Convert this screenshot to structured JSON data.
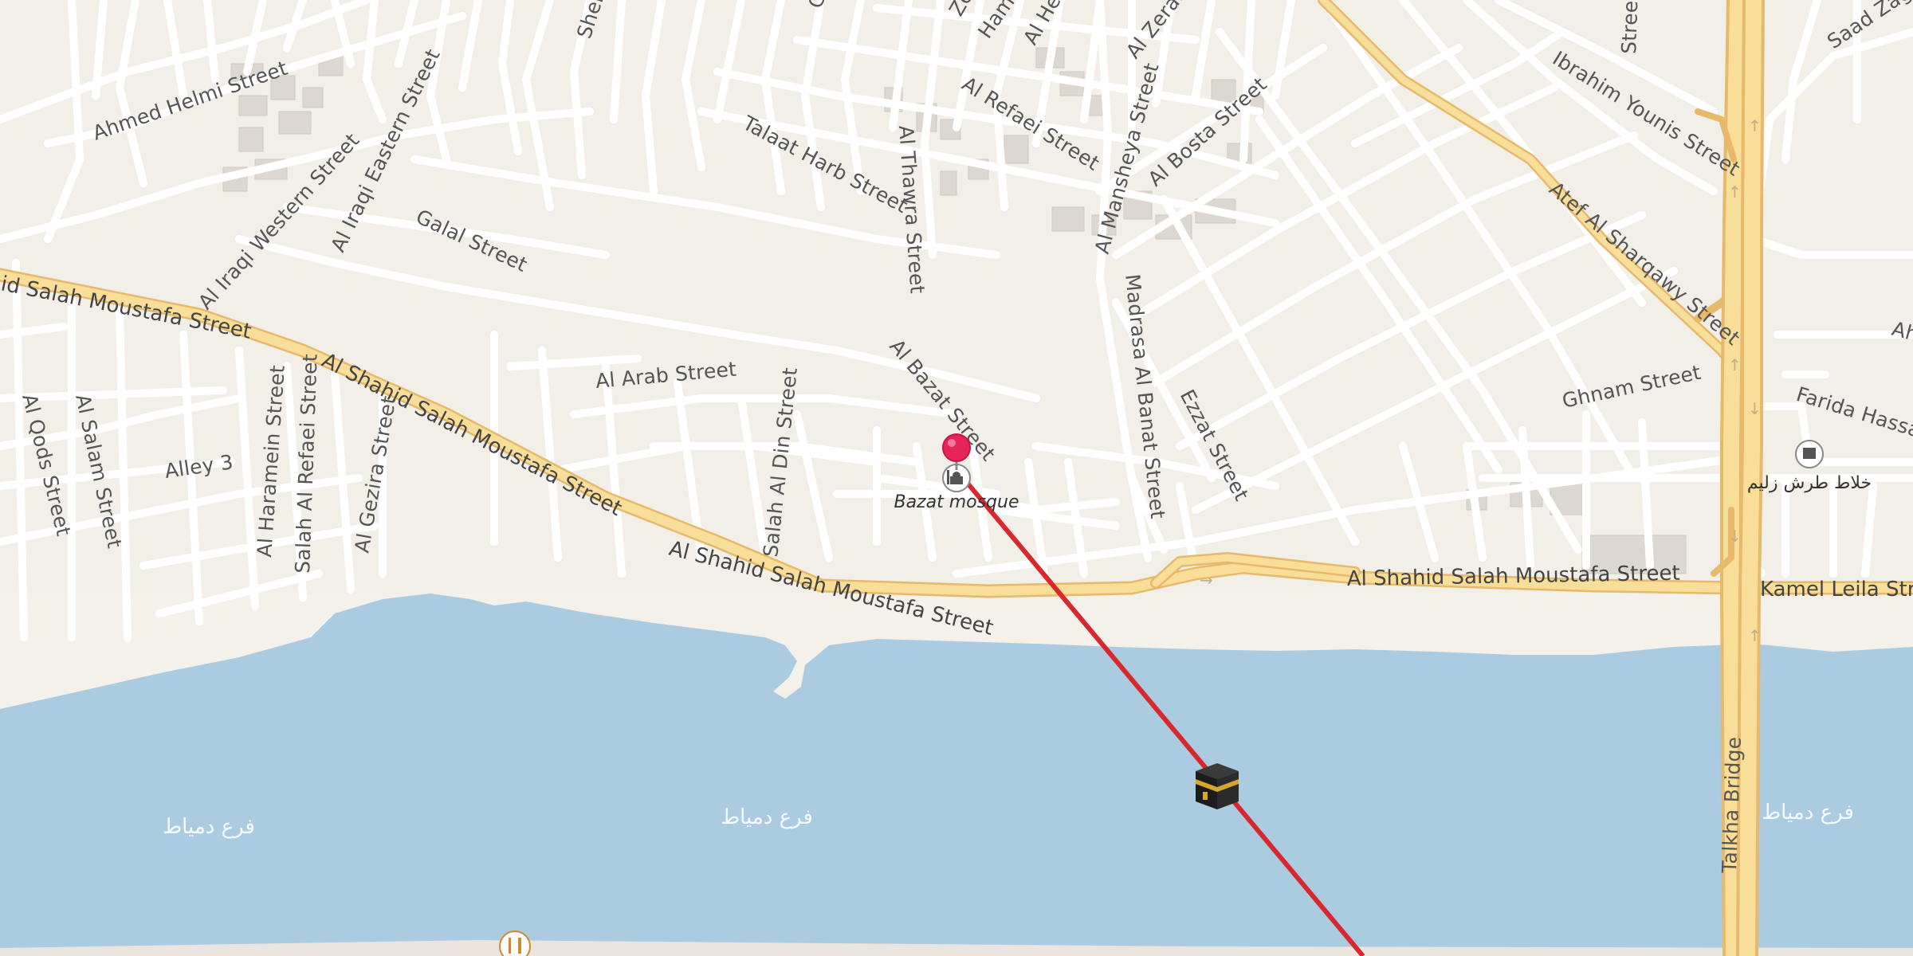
{
  "map": {
    "street_labels": {
      "ahmed_helmi": "Ahmed Helmi Street",
      "talaat_harb": "Talaat Harb Street",
      "al_thawra": "Al Thawra Street",
      "al_refaei": "Al Refaei Street",
      "al_mansheya": "Al Mansheya Street",
      "al_bosta": "Al Bosta Street",
      "al_zeraa": "Al Zeraa",
      "al_heri": "Al Hei",
      "hamo": "Hamo",
      "zey": "Zey",
      "shel": "Shel",
      "g_top": "G",
      "al_iraqi_eastern": "Al Iraqi Eastern Street",
      "al_iraqi_western": "Al Iraqi Western Street",
      "galal": "Galal Street",
      "salah_moustafa_w": "id Salah Moustafa Street",
      "salah_moustafa_diag": "Al Shahid Salah Moustafa Street",
      "salah_moustafa_bottom": "Al Shahid Salah Moustafa Street",
      "salah_moustafa_e": "Al Shahid Salah Moustafa Street",
      "al_arab": "Al Arab Street",
      "al_bazat": "Al Bazat Street",
      "madrasa_al_banat": "Madrasa Al Banat Street",
      "ezzat": "Ezzat Street",
      "salah_al_din": "Salah Al Din Street",
      "al_qods": "Al Qods Street",
      "al_salam": "Al Salam Street",
      "alley_3": "Alley 3",
      "al_haramein": "Al Haramein Street",
      "salah_al_refaei": "Salah Al Refaei Street",
      "al_gezira": "Al Gezira Street",
      "atef_al_sharqawy": "Atef Al Sharqawy Street",
      "ibrahim_younis": "Ibrahim Younis Street",
      "ghnam": "Ghnam Street",
      "farida_hassan": "Farida Hassa",
      "kamel_leila": "Kamel Leila Stre",
      "talkha_bridge": "Talkha Bridge",
      "saad_zag": "Saad Zag",
      "street_top_right": "Street",
      "ah_right": "Ah"
    },
    "water_labels": [
      "فرع دمياط",
      "فرع دمياط",
      "فرع دمياط"
    ],
    "poi": {
      "mosque_name": "Bazat mosque",
      "shop_name": "خلاط طرش زليم"
    },
    "colors": {
      "land": "#f2efe9",
      "water": "#abcbe1",
      "road": "#ffffff",
      "road_outline": "#d9d4cd",
      "primary_road": "#f9de9a",
      "primary_outline": "#e6b96b",
      "direction_line": "#d8282d",
      "pin": "#e5245a",
      "building": "#dcd7d0"
    },
    "icons": {
      "location_pin": "red-pin-icon",
      "mosque": "mosque-icon",
      "kaaba": "kaaba-icon",
      "restaurant": "fork-knife-icon",
      "shop": "shop-icon"
    }
  }
}
